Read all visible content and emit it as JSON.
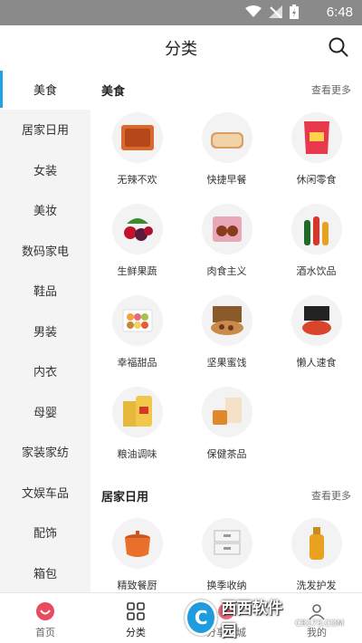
{
  "status": {
    "time": "6:48"
  },
  "header": {
    "title": "分类"
  },
  "sidebar": {
    "items": [
      {
        "label": "美食"
      },
      {
        "label": "居家日用"
      },
      {
        "label": "女装"
      },
      {
        "label": "美妆"
      },
      {
        "label": "数码家电"
      },
      {
        "label": "鞋品"
      },
      {
        "label": "男装"
      },
      {
        "label": "内衣"
      },
      {
        "label": "母婴"
      },
      {
        "label": "家装家纺"
      },
      {
        "label": "文娱车品"
      },
      {
        "label": "配饰"
      },
      {
        "label": "箱包"
      }
    ],
    "active": "美食"
  },
  "sections": [
    {
      "title": "美食",
      "more": "查看更多",
      "items": [
        {
          "label": "无辣不欢"
        },
        {
          "label": "快捷早餐"
        },
        {
          "label": "休闲零食"
        },
        {
          "label": "生鲜果蔬"
        },
        {
          "label": "肉食主义"
        },
        {
          "label": "酒水饮品"
        },
        {
          "label": "幸福甜品"
        },
        {
          "label": "坚果蜜饯"
        },
        {
          "label": "懒人速食"
        },
        {
          "label": "粮油调味"
        },
        {
          "label": "保健茶品"
        }
      ]
    },
    {
      "title": "居家日用",
      "more": "查看更多",
      "items": [
        {
          "label": "精致餐厨"
        },
        {
          "label": "换季收纳"
        },
        {
          "label": "洗发护发"
        }
      ]
    }
  ],
  "tabbar": [
    {
      "label": "首页"
    },
    {
      "label": "分类"
    },
    {
      "label": "分享商城"
    },
    {
      "label": "我的"
    }
  ],
  "watermark": {
    "logo": "C",
    "text": "西西软件园",
    "sub": "CR173.COM"
  },
  "colors": {
    "accent": "#21a1e6",
    "statusbar": "#8a8a8a",
    "sidebar_bg": "#f4f4f4",
    "home_icon": "#e84a5f"
  }
}
